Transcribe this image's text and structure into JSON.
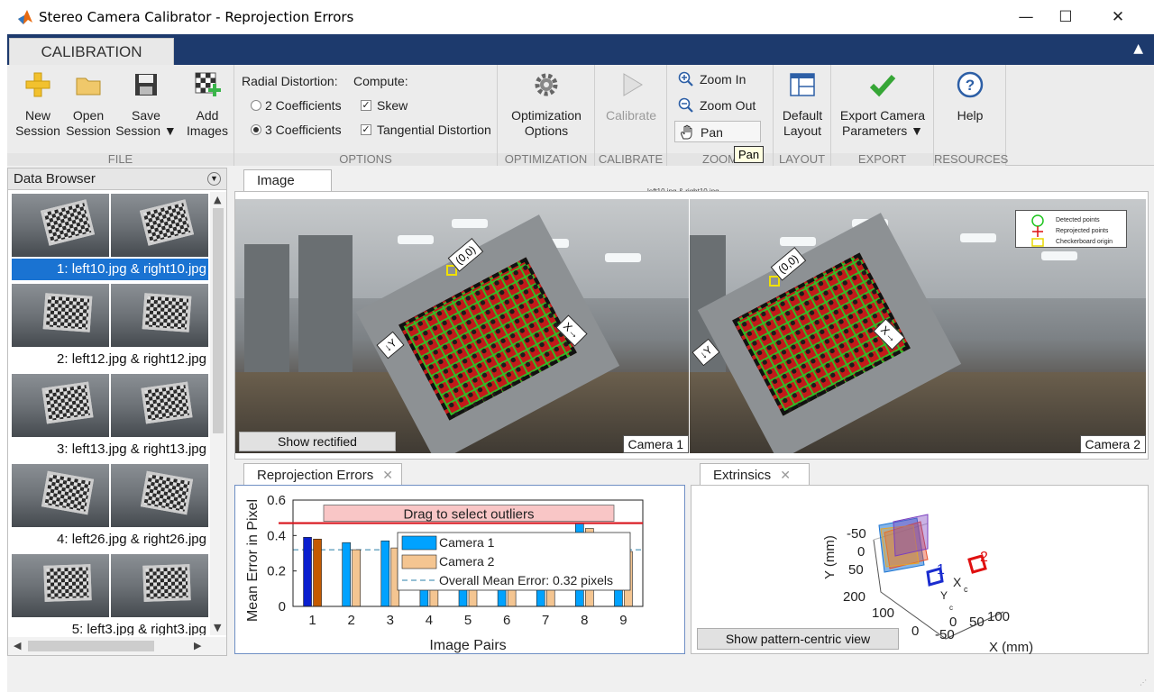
{
  "window": {
    "title": "Stereo Camera Calibrator - Reprojection Errors",
    "minimize": "—",
    "maximize": "☐",
    "close": "✕"
  },
  "ribbon": {
    "tab": "CALIBRATION",
    "file": {
      "label": "FILE",
      "new_session": [
        "New",
        "Session"
      ],
      "open_session": [
        "Open",
        "Session"
      ],
      "save_session": [
        "Save",
        "Session ▼"
      ],
      "add_images": [
        "Add",
        "Images"
      ]
    },
    "options": {
      "label": "OPTIONS",
      "radial_distortion": "Radial Distortion:",
      "coef2": "2 Coefficients",
      "coef3": "3 Coefficients",
      "compute": "Compute:",
      "skew": "Skew",
      "tangential": "Tangential Distortion",
      "selected_radial": "3 Coefficients",
      "skew_checked": true,
      "tangential_checked": true
    },
    "optimization": {
      "label": "OPTIMIZATION",
      "button": [
        "Optimization",
        "Options"
      ]
    },
    "calibrate": {
      "label": "CALIBRATE",
      "button": "Calibrate"
    },
    "zoom": {
      "label": "ZOOM",
      "zoom_in": "Zoom In",
      "zoom_out": "Zoom Out",
      "pan": "Pan"
    },
    "layout": {
      "label": "LAYOUT",
      "button": [
        "Default",
        "Layout"
      ]
    },
    "export": {
      "label": "EXPORT",
      "button": [
        "Export Camera",
        "Parameters ▼"
      ]
    },
    "resources": {
      "label": "RESOURCES",
      "button": "Help"
    },
    "tooltip": "Pan"
  },
  "browser": {
    "title": "Data Browser",
    "items": [
      {
        "label": "1: left10.jpg & right10.jpg",
        "selected": true
      },
      {
        "label": "2: left12.jpg & right12.jpg",
        "selected": false
      },
      {
        "label": "3: left13.jpg & right13.jpg",
        "selected": false
      },
      {
        "label": "4: left26.jpg & right26.jpg",
        "selected": false
      },
      {
        "label": "5: left3.jpg & right3.jpg",
        "selected": false
      }
    ]
  },
  "image_panel": {
    "tab": "Image",
    "title": "left10.jpg & right10.jpg",
    "origin_label": "(0,0)",
    "x_label": "X→",
    "y_label": "↓Y",
    "camera1": "Camera 1",
    "camera2": "Camera 2",
    "show_rectified": "Show rectified",
    "legend": [
      "Detected points",
      "Reprojected points",
      "Checkerboard origin"
    ]
  },
  "reprojection": {
    "tab": "Reprojection Errors",
    "drag_text": "Drag to select outliers"
  },
  "extrinsics": {
    "tab": "Extrinsics",
    "button": "Show pattern-centric view",
    "y_axis_label": "Y (mm)",
    "x_axis_label": "X (mm)",
    "y_ticks": [
      "-50",
      "0",
      "50"
    ],
    "z_ticks": [
      "200",
      "100",
      "0"
    ],
    "x_ticks": [
      "-50",
      "0",
      "50",
      "100"
    ],
    "camera_labels": [
      "1",
      "2"
    ],
    "axis_marks": [
      "X",
      "c",
      "Y",
      "c"
    ]
  },
  "chart_data": {
    "type": "bar",
    "categories": [
      "1",
      "2",
      "3",
      "4",
      "5",
      "6",
      "7",
      "8",
      "9"
    ],
    "series": [
      {
        "name": "Camera 1",
        "values": [
          0.39,
          0.36,
          0.37,
          0.3,
          0.28,
          0.29,
          0.3,
          0.47,
          0.34
        ],
        "color": "#00a2ff"
      },
      {
        "name": "Camera 2",
        "values": [
          0.38,
          0.32,
          0.33,
          0.27,
          0.26,
          0.26,
          0.27,
          0.44,
          0.31
        ],
        "color": "#f4c591"
      }
    ],
    "selected_category": "1",
    "selected_colors": {
      "Camera 1": "#0a1fcf",
      "Camera 2": "#c45a00"
    },
    "overall_mean_error": 0.32,
    "overall_mean_label": "Overall Mean Error: 0.32 pixels",
    "threshold_line": 0.47,
    "xlabel": "Image Pairs",
    "ylabel": "Mean Error in Pixel",
    "ylim": [
      0,
      0.6
    ],
    "yticks": [
      "0",
      "0.2",
      "0.4",
      "0.6"
    ],
    "legend_position": "center-right",
    "grid": false
  }
}
